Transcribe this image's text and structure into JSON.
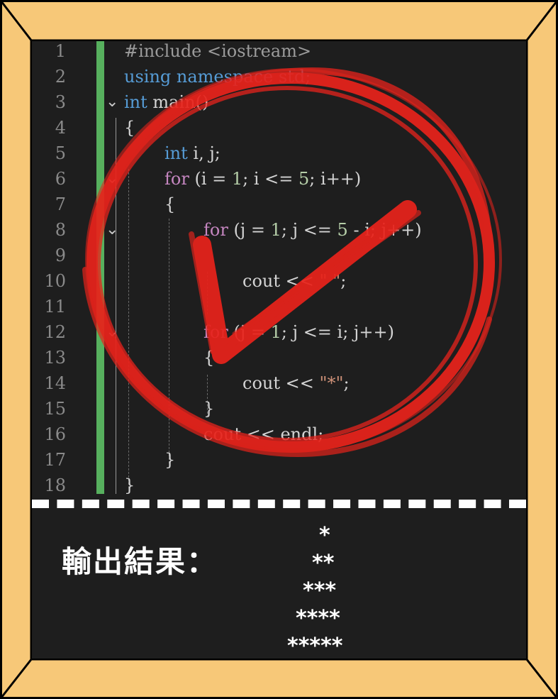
{
  "code": {
    "lines": [
      {
        "num": "1"
      },
      {
        "num": "2"
      },
      {
        "num": "3"
      },
      {
        "num": "4"
      },
      {
        "num": "5"
      },
      {
        "num": "6"
      },
      {
        "num": "7"
      },
      {
        "num": "8"
      },
      {
        "num": "9"
      },
      {
        "num": "10"
      },
      {
        "num": "11"
      },
      {
        "num": "12"
      },
      {
        "num": "13"
      },
      {
        "num": "14"
      },
      {
        "num": "15"
      },
      {
        "num": "16"
      },
      {
        "num": "17"
      },
      {
        "num": "18"
      }
    ],
    "text": {
      "l1": "#include <iostream>",
      "l2": "using namespace std;",
      "l3_kw": "int",
      "l3_rest": " main()",
      "l4": "{",
      "l5_kw": "int",
      "l5_rest": " i, j;",
      "l6_kw": "for",
      "l6_a": " (i = ",
      "l6_n1": "1",
      "l6_b": "; i <= ",
      "l6_n2": "5",
      "l6_c": "; i++)",
      "l7": "{",
      "l8_kw": "for",
      "l8_a": " (j = ",
      "l8_n1": "1",
      "l8_b": "; j <= ",
      "l8_n2": "5",
      "l8_c": " - i; j++)",
      "l10_a": "cout << ",
      "l10_s": "\" \"",
      "l10_b": ";",
      "l12_kw": "for",
      "l12_a": " (j = ",
      "l12_n1": "1",
      "l12_b": "; j <= i; j++)",
      "l13": "{",
      "l14_a": "cout << ",
      "l14_s": "\"*\"",
      "l14_b": ";",
      "l15": "}",
      "l16": "cout << endl;",
      "l17": "}",
      "l18": "}"
    }
  },
  "output": {
    "label": "輸出結果：",
    "lines": [
      "*",
      "**",
      "***",
      "****",
      "*****"
    ]
  },
  "colors": {
    "frame": "#f7c878",
    "screen": "#1e1e1e",
    "stamp": "#e8231b",
    "bar": "#57b05e"
  }
}
